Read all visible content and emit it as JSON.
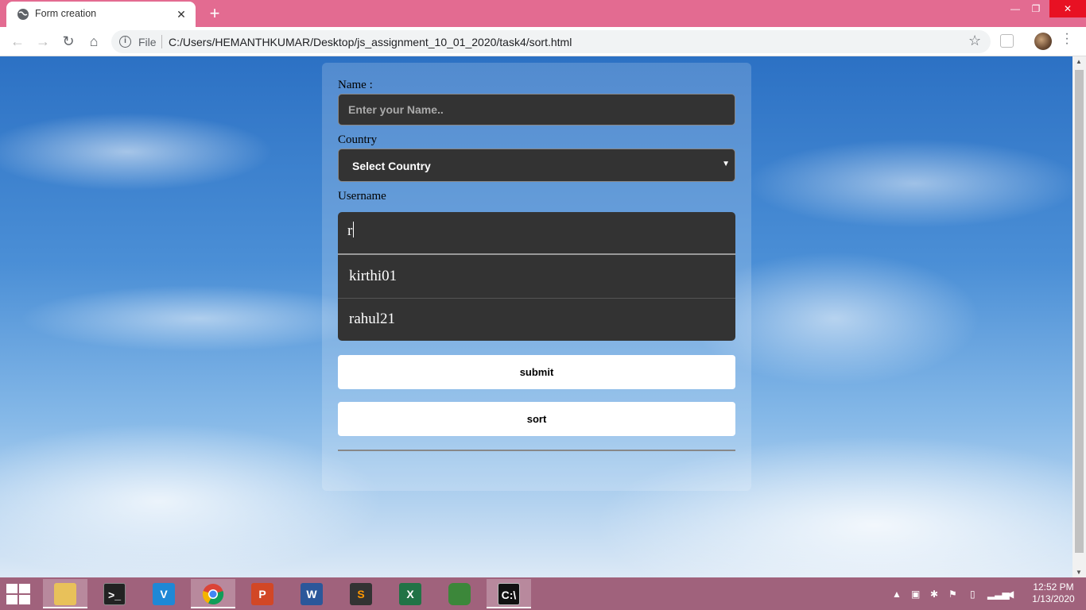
{
  "browser": {
    "tab_title": "Form creation",
    "tab_close": "✕",
    "new_tab": "+",
    "omnibox_scheme": "File",
    "url": "C:/Users/HEMANTHKUMAR/Desktop/js_assignment_10_01_2020/task4/sort.html",
    "window_controls": {
      "minimize": "—",
      "maximize": "❐",
      "close": "✕"
    }
  },
  "form": {
    "name_label": "Name :",
    "name_placeholder": "Enter your Name..",
    "country_label": "Country",
    "country_selected": "Select Country",
    "username_label": "Username",
    "username_value": "r",
    "suggestions": [
      "kirthi01",
      "rahul21"
    ],
    "submit_label": "submit",
    "sort_label": "sort"
  },
  "taskbar": {
    "time": "12:52 PM",
    "date": "1/13/2020",
    "apps": [
      "file-explorer",
      "terminal",
      "vscode",
      "chrome",
      "powerpoint",
      "word",
      "sublime-text",
      "excel",
      "node",
      "command-prompt"
    ]
  },
  "colors": {
    "titlebar": "#e36b91",
    "field_bg": "#333333",
    "taskbar": "#a0627c"
  }
}
